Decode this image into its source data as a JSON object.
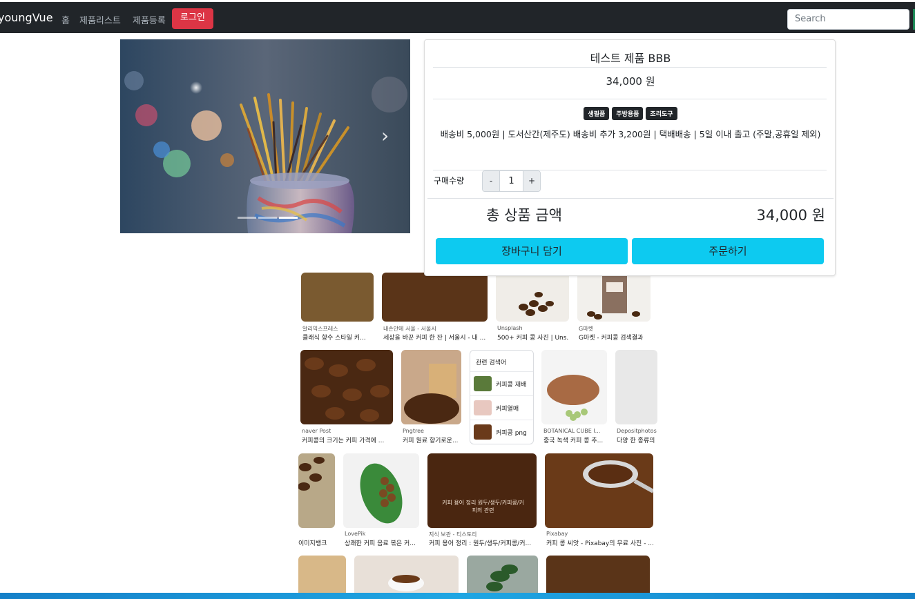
{
  "navbar": {
    "brand": "youngVue",
    "links": [
      "홈",
      "제품리스트",
      "제품등록"
    ],
    "login_label": "로그인",
    "search_placeholder": "Search"
  },
  "carousel": {
    "next_icon": "chevron-right-icon",
    "indicator_count": 3,
    "active_index": 2
  },
  "product": {
    "title": "테스트 제품 BBB",
    "price": "34,000 원",
    "tags": [
      "생필품",
      "주방용품",
      "조리도구"
    ],
    "shipping": "배송비 5,000원 | 도서산간(제주도) 배송비 추가 3,200원 | 택배배송 | 5일 이내 출고 (주말,공휴일 제외)",
    "quantity_label": "구매수량",
    "minus": "-",
    "quantity": "1",
    "plus": "+",
    "total_label": "총 상품 금액",
    "total_value": "34,000 원",
    "cart_button": "장바구니 담기",
    "order_button": "주문하기"
  },
  "background_results": {
    "row1": [
      {
        "source": "알리익스프레스",
        "title": "클래식 향수 스타일 커..."
      },
      {
        "source": "내손안에 서울 - 서울시",
        "title": "세상을 바꾼 커피 한 잔 | 서울시 - 내 ..."
      },
      {
        "source": "Unsplash",
        "title": "500+ 커피 콩 사진 | Uns..."
      },
      {
        "source": "G마켓",
        "title": "G마켓 - 커피콩 검색결과"
      }
    ],
    "row2": [
      {
        "source": "naver Post",
        "title": "커피콩의 크기는 커피 가격에 ..."
      },
      {
        "source": "Pngtree",
        "title": "커피 원료 향기로운..."
      },
      {
        "source": "BOTANICAL CUBE I...",
        "title": "중국 녹색 커피 콩 추..."
      },
      {
        "source": "Depositphotos",
        "title": "다양 한 종류의"
      }
    ],
    "related": {
      "heading": "관련 검색어",
      "items": [
        "커피콩 재배",
        "커피열매",
        "커피콩 png"
      ]
    },
    "row3": [
      {
        "source": "",
        "title": "이미지뱅크"
      },
      {
        "source": "LovePik",
        "title": "상쾌한 커피 음료 볶은 커..."
      },
      {
        "source": "지식 보관 - 티스토리",
        "title": "커피 용어 정리 : 원두/생두/커피콩/커..."
      },
      {
        "source": "Pixabay",
        "title": "커피 콩 씨앗 - Pixabay의 무료 사진 - ..."
      }
    ],
    "overlay_text": "커피 용어 정리 원두/생두/커피콩/커피의 관련"
  }
}
